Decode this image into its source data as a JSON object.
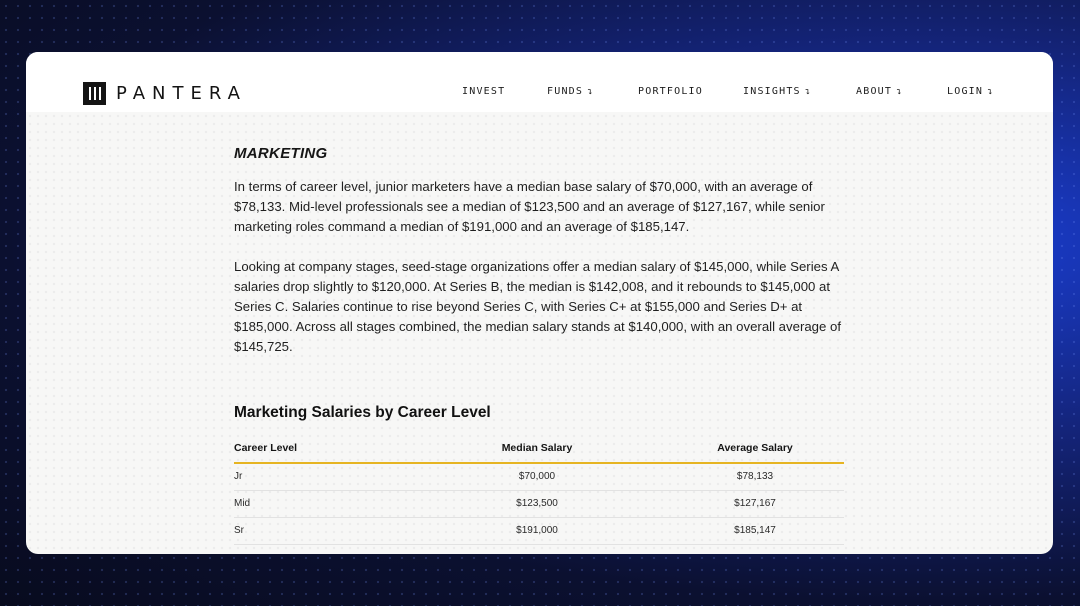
{
  "brand": {
    "name": "PANTERA"
  },
  "nav": {
    "items": [
      {
        "label": "INVEST",
        "arrow": ""
      },
      {
        "label": "FUNDS",
        "arrow": "↴"
      },
      {
        "label": "PORTFOLIO",
        "arrow": ""
      },
      {
        "label": "INSIGHTS",
        "arrow": "↴"
      },
      {
        "label": "ABOUT",
        "arrow": "↴"
      },
      {
        "label": "LOGIN",
        "arrow": "↴"
      }
    ]
  },
  "article": {
    "section_title": "MARKETING",
    "paragraphs": [
      "In terms of career level, junior marketers have a median base salary of $70,000, with an average of $78,133. Mid-level professionals see a median of $123,500 and an average of $127,167, while senior marketing roles command a median of $191,000 and an average of $185,147.",
      "Looking at company stages, seed-stage organizations offer a median salary of $145,000, while Series A salaries drop slightly to $120,000. At Series B, the median is $142,008, and it rebounds to $145,000 at Series C. Salaries continue to rise beyond Series C, with Series C+ at $155,000 and Series D+ at $185,000. Across all stages combined, the median salary stands at $140,000, with an overall average of $145,725."
    ]
  },
  "table": {
    "title": "Marketing Salaries by Career Level",
    "columns": [
      "Career Level",
      "Median Salary",
      "Average Salary"
    ],
    "rows": [
      [
        "Jr",
        "$70,000",
        "$78,133"
      ],
      [
        "Mid",
        "$123,500",
        "$127,167"
      ],
      [
        "Sr",
        "$191,000",
        "$185,147"
      ]
    ]
  },
  "colors": {
    "accent_rule": "#e6b422",
    "background_blue": "#1a3fd6",
    "text": "#1e1e1e"
  }
}
